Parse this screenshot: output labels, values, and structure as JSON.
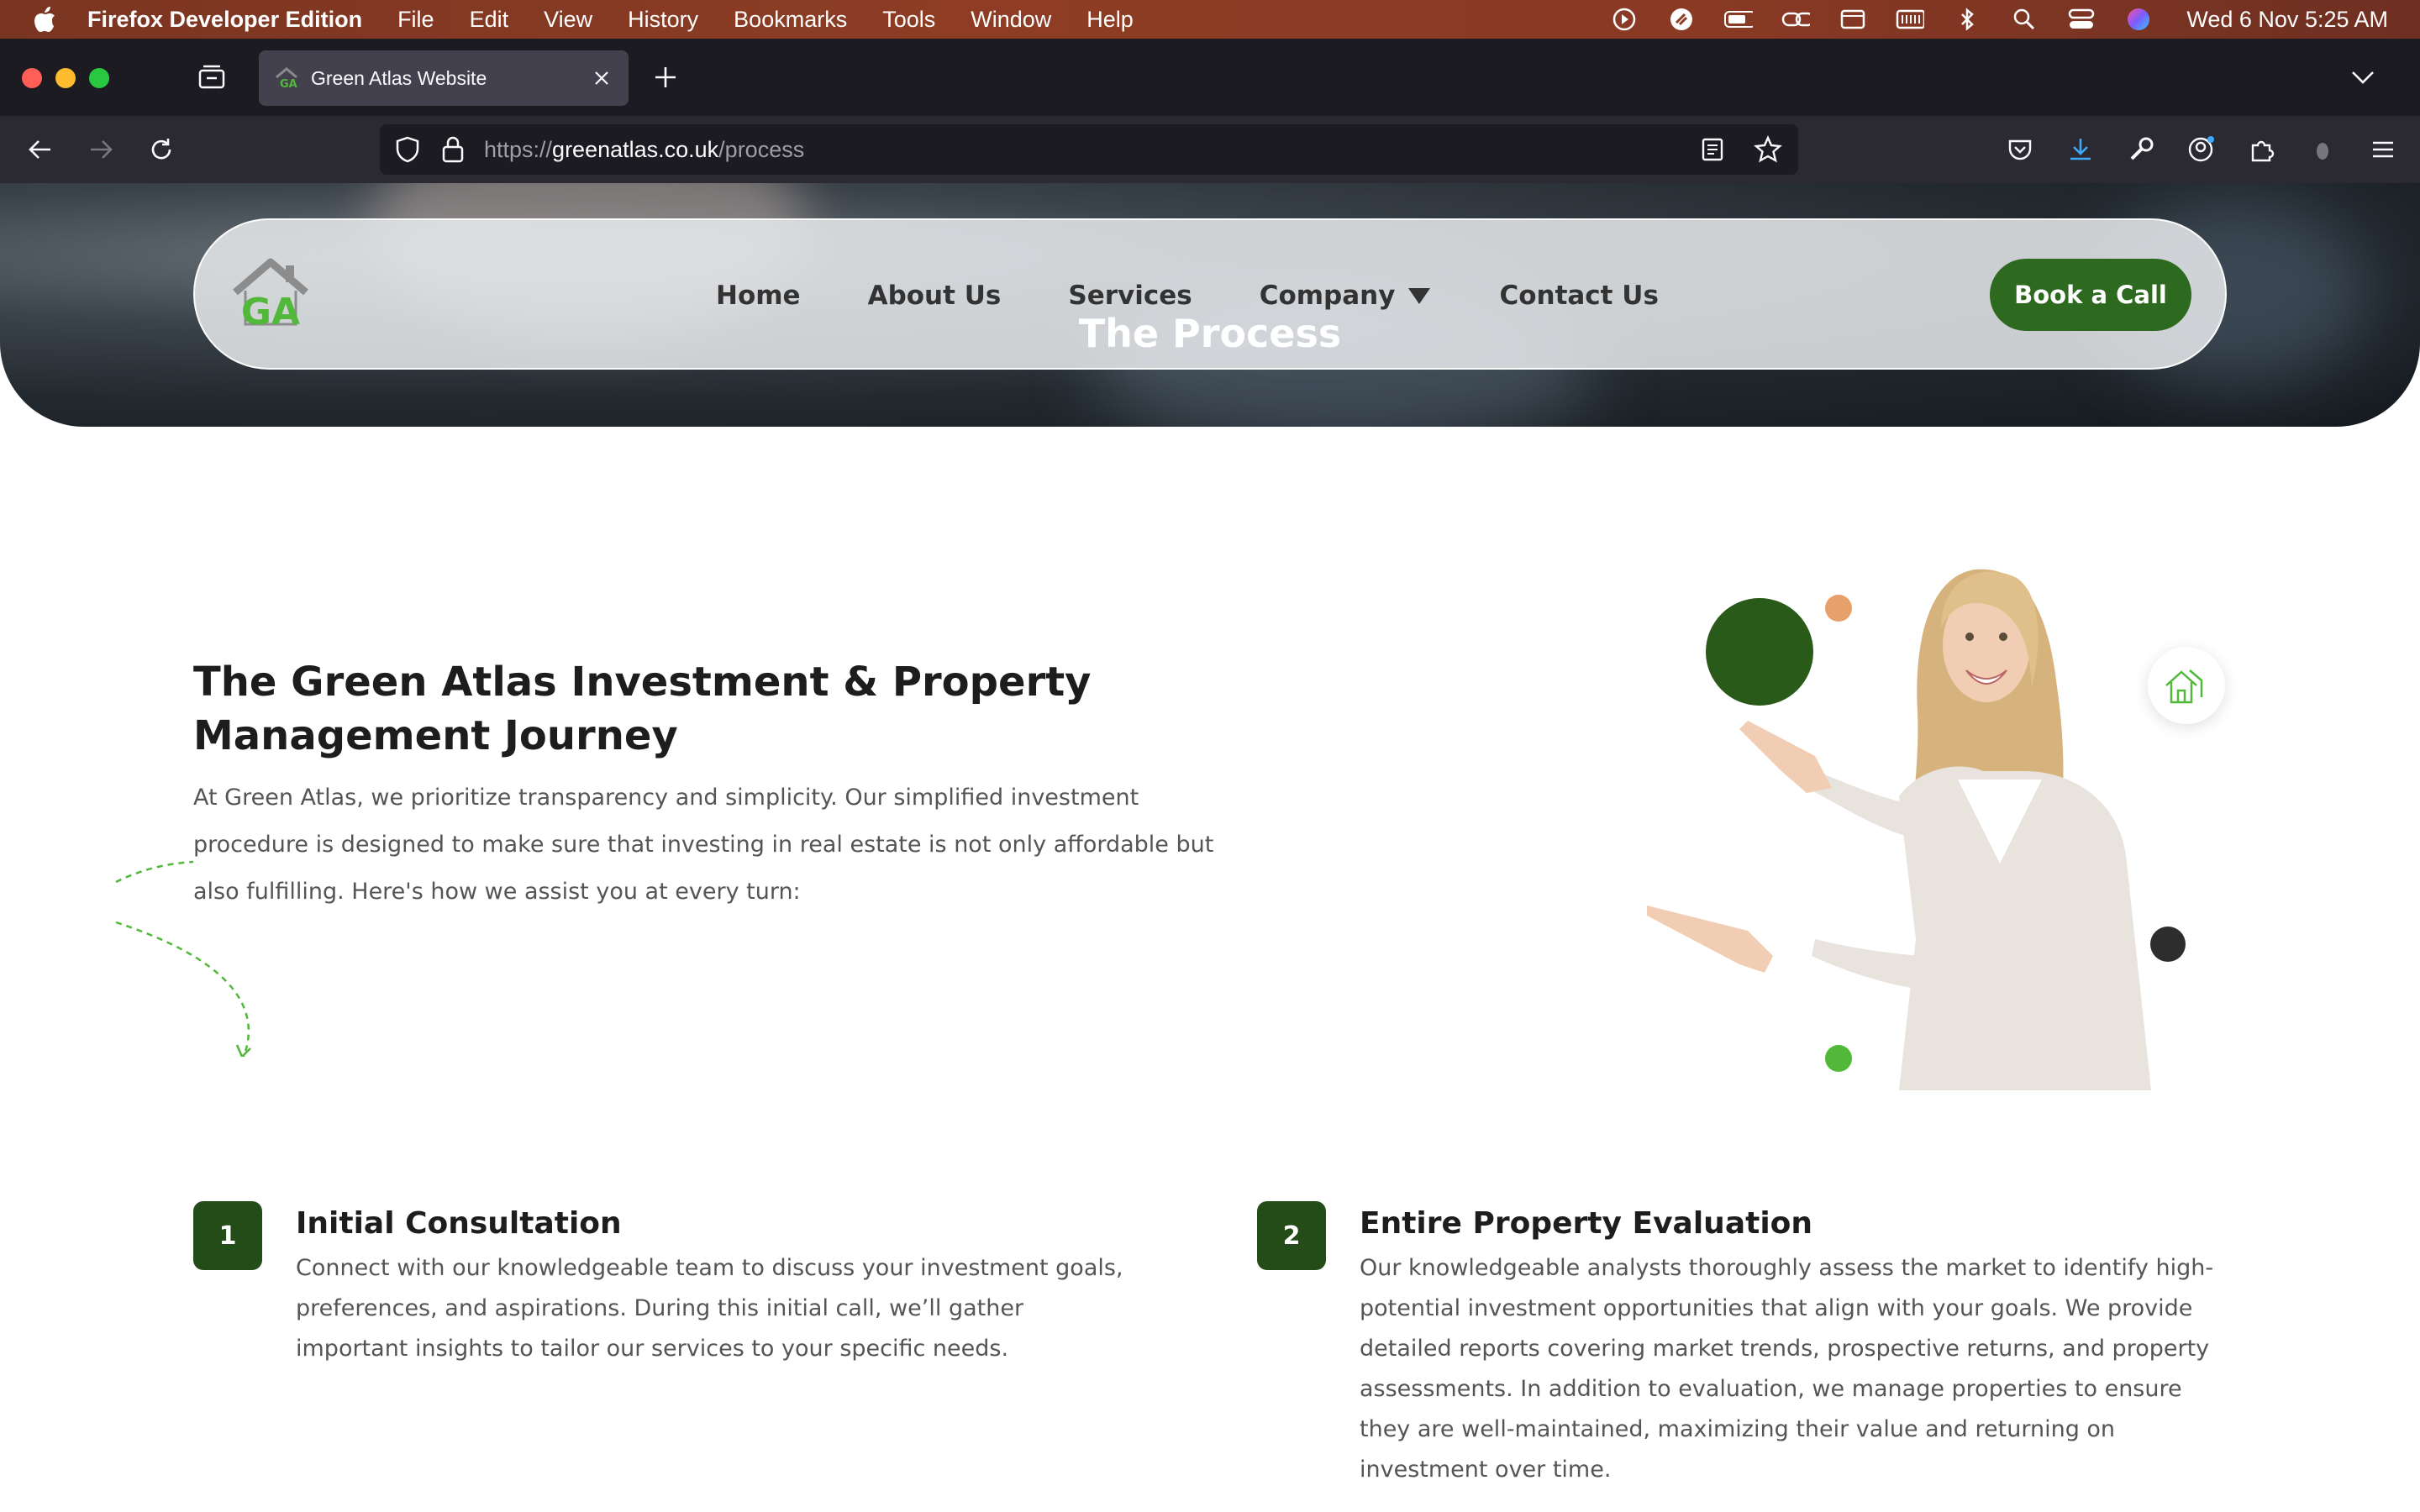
{
  "menubar": {
    "app_name": "Firefox Developer Edition",
    "items": [
      "File",
      "Edit",
      "View",
      "History",
      "Bookmarks",
      "Tools",
      "Window",
      "Help"
    ],
    "clock": "Wed 6 Nov  5:25 AM"
  },
  "browser": {
    "tab_title": "Green Atlas Website",
    "url_scheme": "https://",
    "url_host": "greenatlas.co.uk",
    "url_path": "/process"
  },
  "site": {
    "nav": {
      "home": "Home",
      "about": "About Us",
      "services": "Services",
      "company": "Company",
      "contact": "Contact Us",
      "cta": "Book a Call"
    },
    "logo_text": "GA",
    "hero_title": "The Process",
    "journey": {
      "title": "The Green Atlas Investment & Property Management Journey",
      "description": "At Green Atlas, we prioritize transparency and simplicity. Our simplified investment procedure is designed to make sure that investing in real estate is not only affordable but also fulfilling. Here's how we assist you at every turn:"
    },
    "steps": [
      {
        "number": "1",
        "title": "Initial Consultation",
        "description": "Connect with our knowledgeable team to discuss your investment goals, preferences, and aspirations. During this initial call, we’ll gather important insights to tailor our services to your specific needs."
      },
      {
        "number": "2",
        "title": "Entire Property Evaluation",
        "description": "Our knowledgeable analysts thoroughly assess the market to identify high-potential investment opportunities that align with your goals. We provide detailed reports covering market trends, prospective returns, and property assessments. In addition to evaluation, we manage properties to ensure they are well-maintained, maximizing their value and returning on investment over time."
      }
    ],
    "colors": {
      "brand_green": "#2d6a1f",
      "badge_green": "#234c19",
      "accent_orange": "#e8a06a",
      "light_green": "#52b83a"
    }
  }
}
